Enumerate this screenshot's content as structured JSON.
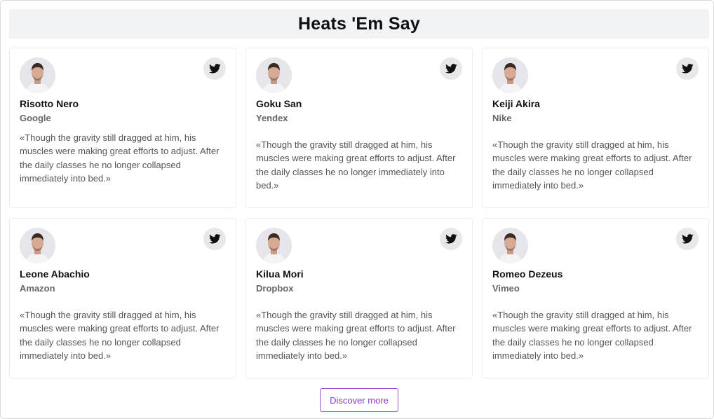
{
  "header": {
    "title": "Heats 'Em Say"
  },
  "testimonials": [
    {
      "name": "Risotto Nero",
      "company": "Google",
      "quote": "«Though the gravity still dragged at him, his muscles were making great efforts to adjust. After the daily classes he no longer collapsed immediately into bed.»"
    },
    {
      "name": "Goku San",
      "company": "Yendex",
      "quote": "«Though the gravity still dragged at him, his muscles were making great efforts to adjust. After the daily classes he no longer immediately into bed.»"
    },
    {
      "name": "Keiji Akira",
      "company": "Nike",
      "quote": "«Though the gravity still dragged at him, his muscles were making great efforts to adjust. After the daily classes he no longer collapsed immediately into bed.»"
    },
    {
      "name": "Leone Abachio",
      "company": "Amazon",
      "quote": "«Though the gravity still dragged at him, his muscles were making great efforts to adjust. After the daily classes he no longer collapsed immediately into bed.»"
    },
    {
      "name": "Kilua Mori",
      "company": "Dropbox",
      "quote": "«Though the gravity still dragged at him, his muscles were making great efforts to adjust. After the daily classes he no longer collapsed immediately into bed.»"
    },
    {
      "name": "Romeo Dezeus",
      "company": "Vimeo",
      "quote": "«Though the gravity still dragged at him, his muscles were making great efforts to adjust. After the daily classes he no longer collapsed immediately into bed.»"
    }
  ],
  "icons": {
    "social": "twitter-icon",
    "avatar": "person-avatar"
  },
  "footer": {
    "discover_label": "Discover more"
  },
  "colors": {
    "accent": "#8b3fc4",
    "title_bar_bg": "#f2f3f5",
    "icon_bg": "#e8e8ea"
  }
}
